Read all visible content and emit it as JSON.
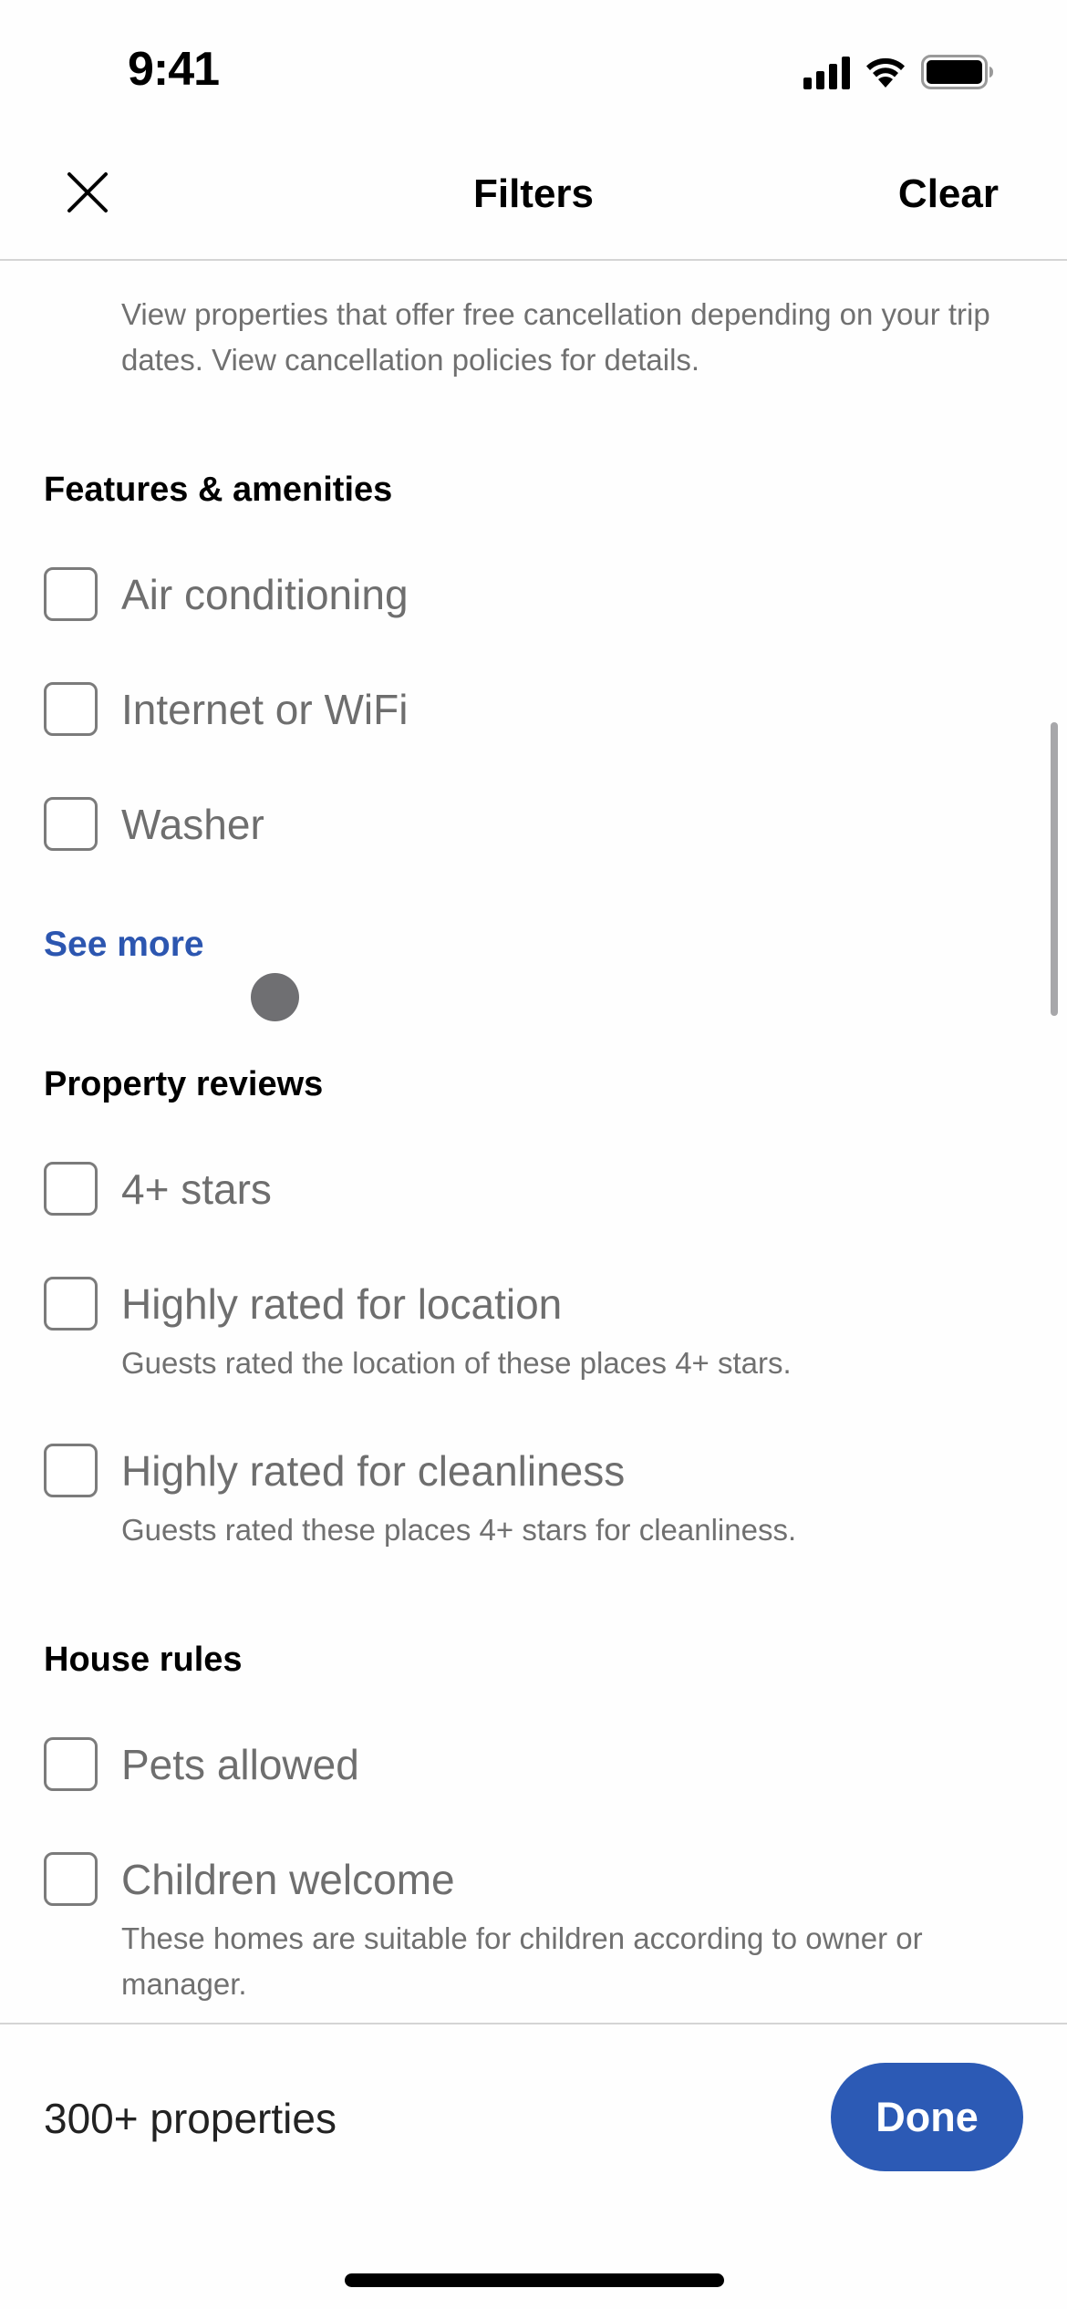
{
  "status_bar": {
    "time": "9:41",
    "icons": [
      "signal-icon",
      "wifi-icon",
      "battery-icon"
    ]
  },
  "nav": {
    "close_icon": "close-icon",
    "title": "Filters",
    "clear_label": "Clear"
  },
  "free_cancellation": {
    "description": "View properties that offer free cancellation depending on your trip dates. View cancellation policies for details."
  },
  "features": {
    "heading": "Features & amenities",
    "options": [
      {
        "label": "Air conditioning",
        "checked": false
      },
      {
        "label": "Internet or WiFi",
        "checked": false
      },
      {
        "label": "Washer",
        "checked": false
      }
    ],
    "see_more_label": "See more"
  },
  "reviews": {
    "heading": "Property reviews",
    "options": [
      {
        "label": "4+ stars",
        "sub": "",
        "checked": false
      },
      {
        "label": "Highly rated for location",
        "sub": "Guests rated the location of these places 4+ stars.",
        "checked": false
      },
      {
        "label": "Highly rated for cleanliness",
        "sub": "Guests rated these places 4+ stars for cleanliness.",
        "checked": false
      }
    ]
  },
  "house_rules": {
    "heading": "House rules",
    "options": [
      {
        "label": "Pets allowed",
        "sub": "",
        "checked": false
      },
      {
        "label": "Children welcome",
        "sub": "These homes are suitable for children according to owner or manager.",
        "checked": false
      }
    ]
  },
  "footer": {
    "result_count": "300+ properties",
    "done_label": "Done"
  },
  "colors": {
    "accent": "#2c5ab5",
    "link": "#2c56b0",
    "checkbox_border": "#7b7b7b",
    "secondary_text": "#707070"
  }
}
